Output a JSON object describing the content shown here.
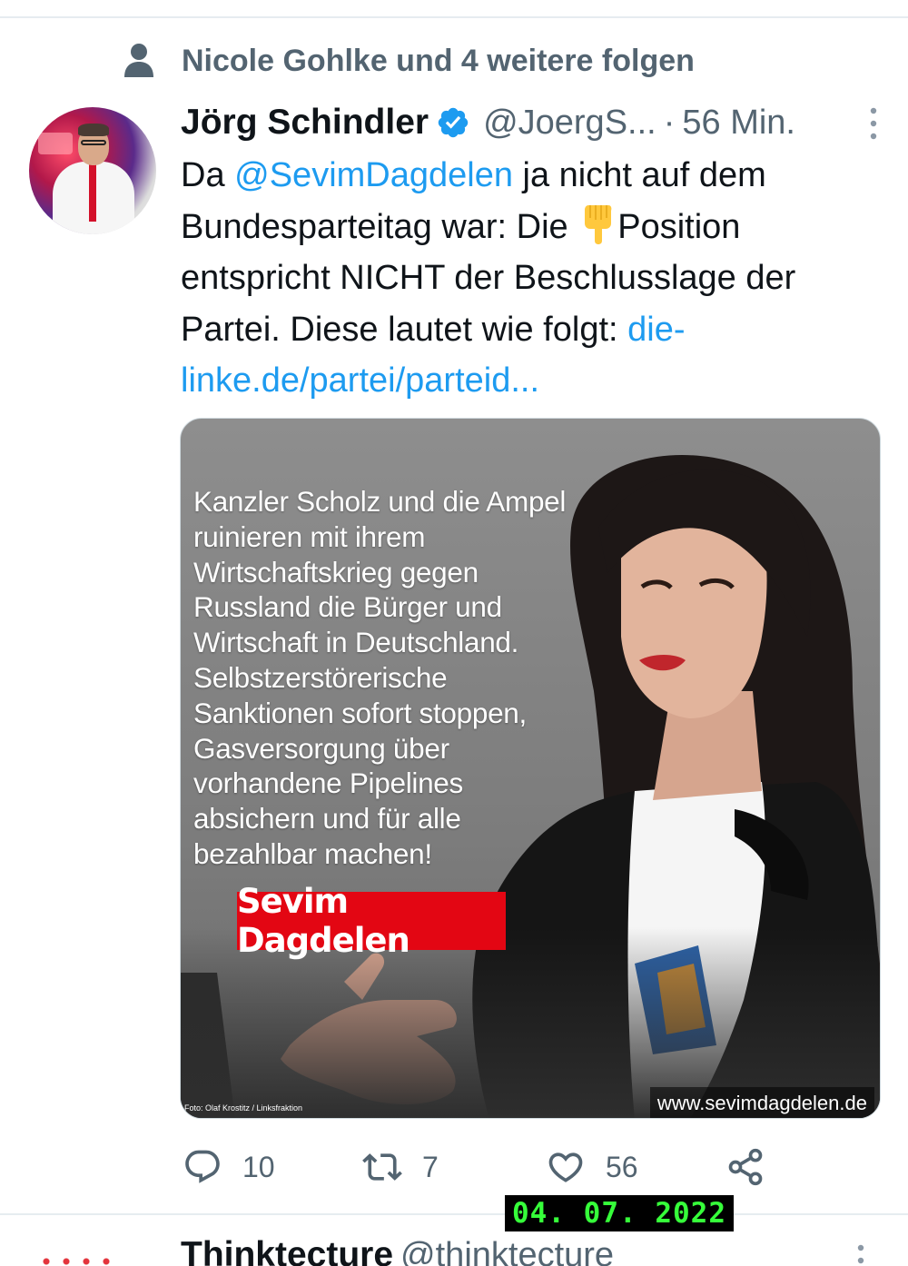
{
  "social_context": {
    "icon": "person-icon",
    "text": "Nicole Gohlke und 4 weitere folgen"
  },
  "tweet": {
    "author_name": "Jörg Schindler",
    "verified": true,
    "handle": "@JoergS...",
    "separator": "·",
    "time": "56 Min.",
    "text_parts": {
      "p1": "Da ",
      "mention": "@SevimDagdelen",
      "p2": " ja nicht auf dem Bundesparteitag war: Die ",
      "emoji": "pointing-down-emoji",
      "p3": "Position entspricht NICHT der Beschlusslage der Partei. Diese lautet wie folgt: ",
      "link": "die-linke.de/partei/parteid..."
    },
    "media": {
      "quote": "Kanzler Scholz und die Ampel ruinieren mit ihrem Wirtschaftskrieg gegen Russland die Bürger und Wirtschaft in Deutschland. Selbstzerstörerische Sanktionen sofort stoppen, Gasversorgung über vorhandene Pipelines absichern und für alle bezahlbar machen!",
      "name_banner": "Sevim Dagdelen",
      "photo_credit": "Foto: Olaf Krostitz / Linksfraktion",
      "website": "www.sevimdagdelen.de",
      "banner_color": "#e30613"
    },
    "actions": {
      "reply_count": "10",
      "retweet_count": "7",
      "like_count": "56"
    }
  },
  "date_stamp": "04. 07. 2022",
  "next_tweet": {
    "author_name": "Thinktecture",
    "handle": "@thinktecture"
  },
  "colors": {
    "link": "#1d9bf0",
    "secondary_text": "#536471",
    "primary_text": "#0f1419",
    "stamp_text": "#36ff3a"
  }
}
